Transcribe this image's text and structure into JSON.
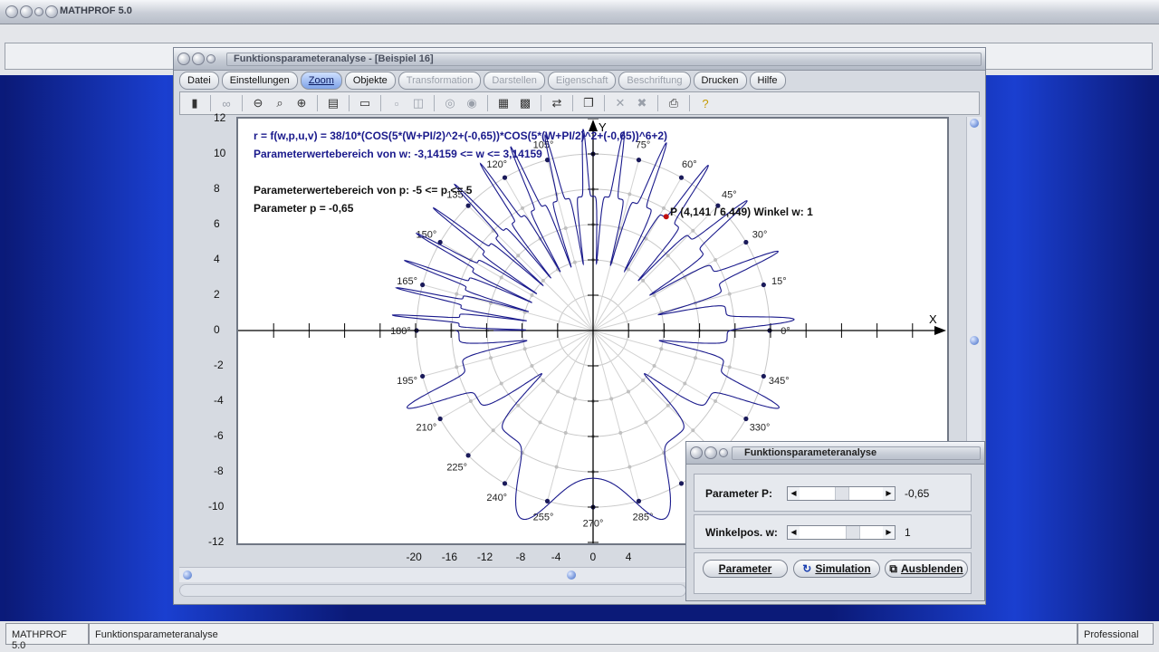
{
  "app": {
    "title": "MATHPROF 5.0"
  },
  "window": {
    "title": "Funktionsparameteranalyse - [Beispiel 16]"
  },
  "menu": [
    {
      "label": "Datei",
      "state": "normal"
    },
    {
      "label": "Einstellungen",
      "state": "normal"
    },
    {
      "label": "Zoom",
      "state": "active"
    },
    {
      "label": "Objekte",
      "state": "normal"
    },
    {
      "label": "Transformation",
      "state": "disabled"
    },
    {
      "label": "Darstellen",
      "state": "disabled"
    },
    {
      "label": "Eigenschaft",
      "state": "disabled"
    },
    {
      "label": "Beschriftung",
      "state": "disabled"
    },
    {
      "label": "Drucken",
      "state": "normal"
    },
    {
      "label": "Hilfe",
      "state": "normal"
    }
  ],
  "toolbar_icons": [
    "device-icon",
    "glasses-icon",
    "zoom-out-icon",
    "zoom-icon",
    "zoom-in-icon",
    "properties-icon",
    "window-icon",
    "box-icon",
    "box-icon-2",
    "circle-icon",
    "circle-icon-2",
    "table-icon",
    "grid-icon",
    "export-icon",
    "copy-icon",
    "cross-icon",
    "cross-icon-2",
    "print-icon",
    "help-icon"
  ],
  "plot": {
    "formula": "r = f(w,p,u,v) = 38/10*(COS(5*(W+PI/2)^2+(-0,65))*COS(5*(W+PI/2)^2+(-0,65))^6+2)",
    "range_w": "Parameterwertebereich von w: -3,14159 <= w <= 3,14159",
    "range_p": "Parameterwertebereich von p: -5 <= p <= 5",
    "param_p": "Parameter p = -0,65",
    "point_label": "P (4,141 / 6,449)  Winkel w: 1",
    "x_axis_label": "X",
    "y_axis_label": "Y",
    "xticks": [
      "-20",
      "-16",
      "-12",
      "-8",
      "-4",
      "0",
      "4"
    ],
    "yticks": [
      "12",
      "10",
      "8",
      "6",
      "4",
      "2",
      "0",
      "-2",
      "-4",
      "-6",
      "-8",
      "-10",
      "-12"
    ],
    "angle_labels": [
      "0°",
      "15°",
      "30°",
      "45°",
      "60°",
      "75°",
      "105°",
      "120°",
      "135°",
      "150°",
      "165°",
      "180°",
      "195°",
      "210°",
      "225°",
      "240°",
      "255°",
      "270°",
      "285°",
      "330°",
      "345°"
    ],
    "curve_color": "#1a1a8c",
    "point_color": "#c01010"
  },
  "chart_data": {
    "type": "line",
    "xlim": [
      -20,
      4
    ],
    "ylim": [
      -12,
      12
    ],
    "x": [
      -20,
      -16,
      -12,
      -8,
      -4,
      0,
      4
    ],
    "y": [
      12,
      10,
      8,
      6,
      4,
      2,
      0,
      -2,
      -4,
      -6,
      -8,
      -10,
      -12
    ],
    "point": {
      "x": 4.141,
      "y": 6.449,
      "w": 1
    }
  },
  "dialog": {
    "title": "Funktionsparameteranalyse",
    "param_label": "Parameter P:",
    "param_value": "-0,65",
    "param_fraction": 0.5,
    "winkel_label": "Winkelpos. w:",
    "winkel_value": "1",
    "winkel_fraction": 0.66,
    "btn_parameter": "Parameter",
    "btn_simulation": "Simulation",
    "btn_ausblenden": "Ausblenden"
  },
  "status": {
    "left": "MATHPROF 5.0",
    "middle": "Funktionsparameteranalyse",
    "right": "Professional"
  }
}
